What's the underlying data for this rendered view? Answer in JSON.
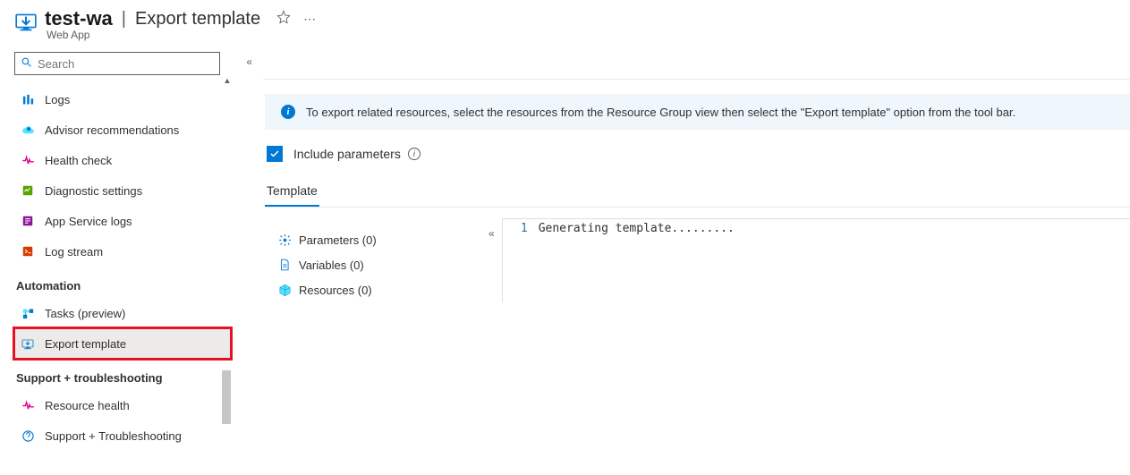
{
  "header": {
    "resource_name": "test-wa",
    "page_title": "Export template",
    "resource_type": "Web App"
  },
  "search": {
    "placeholder": "Search"
  },
  "sidebar": {
    "items_before": [
      {
        "label": "Logs",
        "icon": "logs",
        "color": "#0078d4"
      },
      {
        "label": "Advisor recommendations",
        "icon": "advisor",
        "color": "#0078d4"
      },
      {
        "label": "Health check",
        "icon": "health",
        "color": "#e3008c"
      },
      {
        "label": "Diagnostic settings",
        "icon": "diagnostic",
        "color": "#57a300"
      },
      {
        "label": "App Service logs",
        "icon": "applogs",
        "color": "#881798"
      },
      {
        "label": "Log stream",
        "icon": "logstream",
        "color": "#d83b01"
      }
    ],
    "section_automation": "Automation",
    "items_automation": [
      {
        "label": "Tasks (preview)",
        "icon": "tasks",
        "color": "#0078d4"
      },
      {
        "label": "Export template",
        "icon": "export",
        "color": "#0078d4",
        "highlighted": true
      }
    ],
    "section_support": "Support + troubleshooting",
    "items_support": [
      {
        "label": "Resource health",
        "icon": "reshealth",
        "color": "#e3008c"
      },
      {
        "label": "Support + Troubleshooting",
        "icon": "support",
        "color": "#0078d4"
      }
    ]
  },
  "main": {
    "info_text": "To export related resources, select the resources from the Resource Group view then select the \"Export template\" option from the tool bar.",
    "include_params_label": "Include parameters",
    "tab_template": "Template",
    "tree": {
      "parameters": "Parameters (0)",
      "variables": "Variables (0)",
      "resources": "Resources (0)"
    },
    "editor": {
      "line1_num": "1",
      "line1_text": "Generating template........."
    }
  }
}
